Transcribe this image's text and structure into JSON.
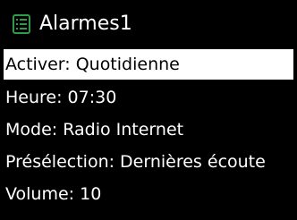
{
  "header": {
    "icon": "list-icon",
    "title": "Alarmes1"
  },
  "menu": {
    "selected_index": 0,
    "items": [
      {
        "label": "Activer: Quotidienne"
      },
      {
        "label": "Heure: 07:30"
      },
      {
        "label": "Mode: Radio Internet"
      },
      {
        "label": "Présélection: Dernières écoute"
      },
      {
        "label": "Volume: 10"
      }
    ]
  },
  "colors": {
    "background": "#000000",
    "text": "#ffffff",
    "highlight": "#ffffff",
    "highlight_text": "#000000",
    "icon_accent": "#2e9a4a"
  }
}
